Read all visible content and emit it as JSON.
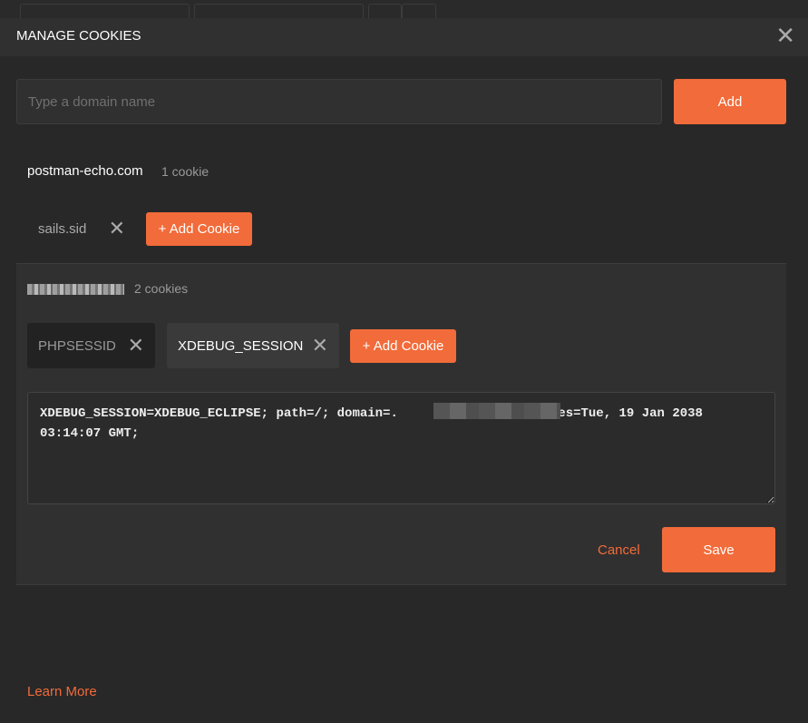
{
  "modal": {
    "title": "MANAGE COOKIES"
  },
  "domain_input": {
    "placeholder": "Type a domain name",
    "value": ""
  },
  "add_label": "Add",
  "domains": [
    {
      "name": "postman-echo.com",
      "count": "1 cookie",
      "cookies": [
        "sails.sid"
      ]
    },
    {
      "name": "[redacted].local",
      "count": "2 cookies",
      "cookies": [
        "PHPSESSID",
        "XDEBUG_SESSION"
      ],
      "selected": "XDEBUG_SESSION"
    }
  ],
  "add_cookie_label": "+ Add Cookie",
  "editor": {
    "value": "XDEBUG_SESSION=XDEBUG_ECLIPSE; path=/; domain=.              ; Expires=Tue, 19 Jan 2038 03:14:07 GMT;"
  },
  "cancel_label": "Cancel",
  "save_label": "Save",
  "learn_more": "Learn More",
  "colors": {
    "accent": "#f26b3a",
    "background": "#282828"
  }
}
